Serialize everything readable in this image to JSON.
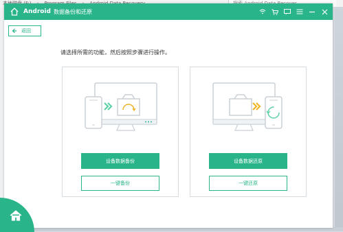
{
  "explorer": {
    "path": [
      "本地磁盘 (F:)",
      "Program Files",
      "Android Data Recovery"
    ],
    "search_placeholder": "搜索 Android Data Recover..."
  },
  "app": {
    "brand": "Android",
    "subtitle": "数据备份和还原",
    "accent": "#29b48a",
    "icons": [
      "wifi-icon",
      "cart-icon",
      "chat-icon",
      "menu-icon",
      "minimize-icon",
      "close-icon"
    ]
  },
  "back_label": "返回",
  "instruction": "请选择所需的功能，然后按照步骤进行操作。",
  "backup": {
    "primary_label": "设备数据备份",
    "secondary_label": "一键备份"
  },
  "restore": {
    "primary_label": "设备数据还原",
    "secondary_label": "一键还原"
  }
}
